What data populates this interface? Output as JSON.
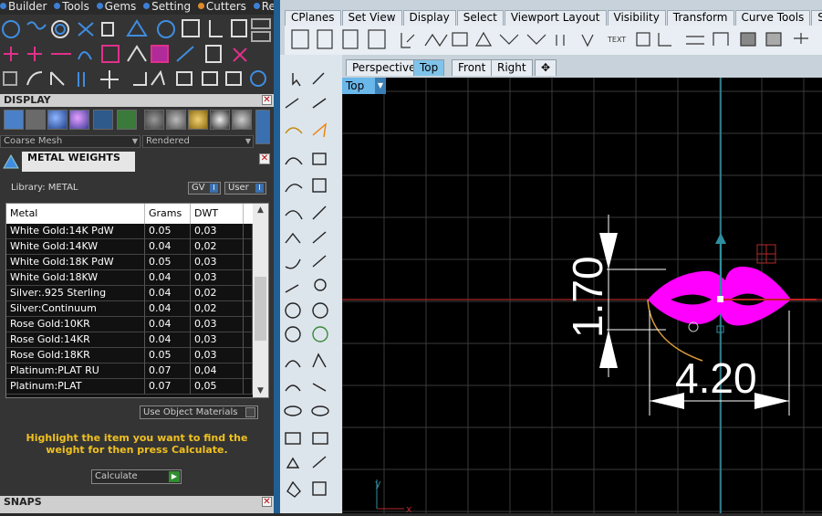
{
  "menubar": {
    "items": [
      "Builder",
      "Tools",
      "Gems",
      "Setting",
      "Cutters",
      "Render"
    ]
  },
  "display_panel": {
    "title": "DISPLAY",
    "mesh_select": "Coarse Mesh",
    "render_select": "Rendered"
  },
  "metal_weights": {
    "title": "METAL WEIGHTS",
    "library_label": "Library: METAL",
    "gv_label": "GV",
    "user_label": "User",
    "columns": [
      "Metal",
      "Grams",
      "DWT"
    ],
    "rows": [
      {
        "metal": "White Gold:14K PdW",
        "grams": "0.05",
        "dwt": "0,03"
      },
      {
        "metal": "White Gold:14KW",
        "grams": "0.04",
        "dwt": "0,02"
      },
      {
        "metal": "White Gold:18K PdW",
        "grams": "0.05",
        "dwt": "0,03"
      },
      {
        "metal": "White Gold:18KW",
        "grams": "0.04",
        "dwt": "0,03"
      },
      {
        "metal": "Silver:.925 Sterling",
        "grams": "0.04",
        "dwt": "0,02"
      },
      {
        "metal": "Silver:Continuum",
        "grams": "0.04",
        "dwt": "0,02"
      },
      {
        "metal": "Rose Gold:10KR",
        "grams": "0.04",
        "dwt": "0,03"
      },
      {
        "metal": "Rose Gold:14KR",
        "grams": "0.04",
        "dwt": "0,03"
      },
      {
        "metal": "Rose Gold:18KR",
        "grams": "0.05",
        "dwt": "0,03"
      },
      {
        "metal": "Platinum:PLAT RU",
        "grams": "0.07",
        "dwt": "0,04"
      },
      {
        "metal": "Platinum:PLAT",
        "grams": "0.07",
        "dwt": "0,05"
      }
    ],
    "use_object_materials": "Use Object Materials",
    "hint": "Highlight the item you want to find the weight for then press Calculate.",
    "calculate": "Calculate"
  },
  "snaps": {
    "title": "SNAPS"
  },
  "rhino_tabs": [
    "CPlanes",
    "Set View",
    "Display",
    "Select",
    "Viewport Layout",
    "Visibility",
    "Transform",
    "Curve Tools",
    "Surface Tools"
  ],
  "viewport_tabs": [
    "Perspective",
    "Top",
    "Front",
    "Right"
  ],
  "active_viewport_tab": "Top",
  "viewport": {
    "label": "Top",
    "dimension_vertical": "1.70",
    "dimension_horizontal": "4.20",
    "axis_x": "x",
    "axis_y": "y"
  },
  "colors": {
    "magenta": "#ff00ff",
    "gold_text": "#f0c020",
    "active_tab": "#7fc3ea",
    "grid": "#3a3a3a"
  }
}
